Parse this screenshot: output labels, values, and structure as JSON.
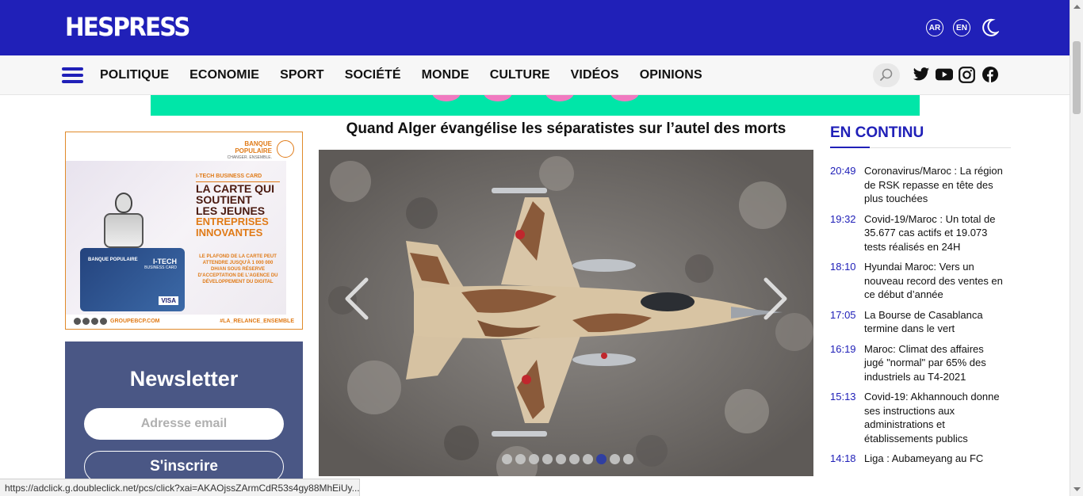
{
  "header": {
    "logo": "HESPRESS",
    "lang_ar": "AR",
    "lang_en": "EN",
    "theme_icon": "moon-icon"
  },
  "nav": {
    "menu_icon": "hamburger-icon",
    "items": [
      {
        "label": "POLITIQUE"
      },
      {
        "label": "ECONOMIE"
      },
      {
        "label": "SPORT"
      },
      {
        "label": "SOCIÉTÉ"
      },
      {
        "label": "MONDE"
      },
      {
        "label": "CULTURE"
      },
      {
        "label": "VIDÉOS"
      },
      {
        "label": "OPINIONS"
      }
    ],
    "search_icon": "search-icon",
    "social": [
      "twitter-icon",
      "youtube-icon",
      "instagram-icon",
      "facebook-icon"
    ]
  },
  "ad": {
    "brand": "BANQUE POPULAIRE",
    "tagline": "CHANGER. ENSEMBLE.",
    "eyebrow": "I-TECH BUSINESS CARD",
    "line1": "LA CARTE QUI",
    "line2": "SOUTIENT",
    "line3": "LES JEUNES",
    "line4": "ENTREPRISES",
    "line5": "INNOVANTES",
    "fine_print": "LE PLAFOND DE LA CARTE PEUT ATTENDRE JUSQU'À 1 000 000 DH/AN SOUS RÉSERVE D'ACCEPTATION DE L'AGENCE DU DÉVELOPPEMENT DU DIGITAL",
    "card_brand": "BANQUE POPULAIRE",
    "card_title": "I-TECH",
    "card_sub": "BUSINESS CARD",
    "card_network": "VISA",
    "site": "GROUPEBCP.COM",
    "hashtag": "#LA_RELANCE_ENSEMBLE"
  },
  "newsletter": {
    "title": "Newsletter",
    "placeholder": "Adresse email",
    "button": "S'inscrire"
  },
  "main": {
    "headline": "Quand Alger évangélise les séparatistes sur l’autel des morts",
    "slides_total": 10,
    "active_slide": 8
  },
  "en_continu": {
    "title": "EN CONTINU",
    "items": [
      {
        "time": "20:49",
        "text": "Coronavirus/Maroc : La région de RSK repasse en tête des plus touchées"
      },
      {
        "time": "19:32",
        "text": "Covid-19/Maroc : Un total de 35.677 cas actifs et 19.073 tests réalisés en 24H"
      },
      {
        "time": "18:10",
        "text": "Hyundai Maroc: Vers un nouveau record des ventes en ce début d’année"
      },
      {
        "time": "17:05",
        "text": "La Bourse de Casablanca termine dans le vert"
      },
      {
        "time": "16:19",
        "text": "Maroc: Climat des affaires jugé \"normal\" par 65% des industriels au T4-2021"
      },
      {
        "time": "15:13",
        "text": "Covid-19: Akhannouch donne ses instructions aux administrations et établissements publics"
      },
      {
        "time": "14:18",
        "text": "Liga : Aubameyang au FC"
      }
    ]
  },
  "status_bar": {
    "url": "https://adclick.g.doubleclick.net/pcs/click?xai=AKAOjssZArmCdR53s4gy88MhEiUy..."
  }
}
